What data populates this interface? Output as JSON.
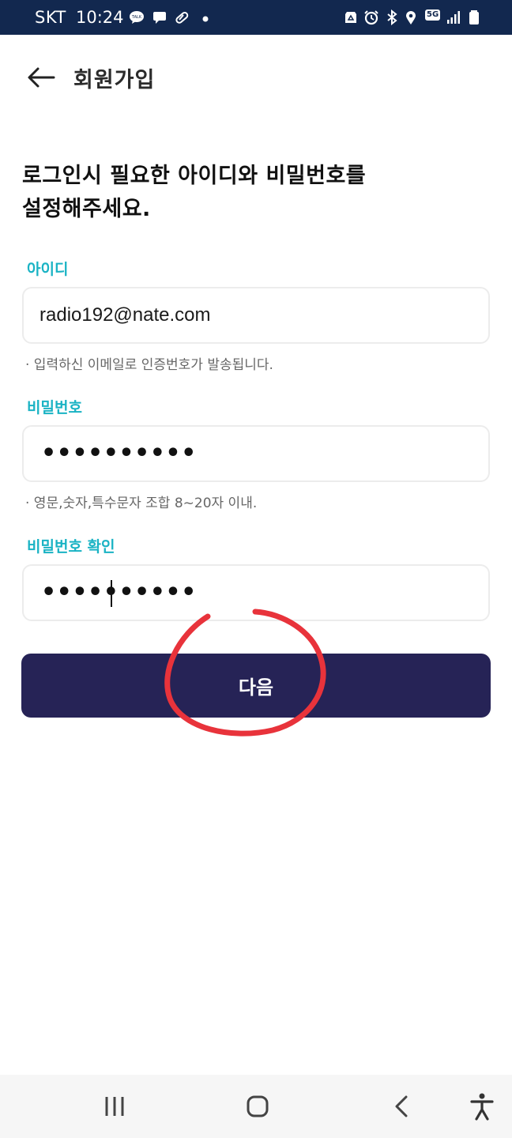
{
  "status_bar": {
    "carrier": "SKT",
    "time": "10:24",
    "network": "5G",
    "left_icons": [
      "kakaotalk-icon",
      "message-icon",
      "pill-icon",
      "dot-icon"
    ],
    "right_icons": [
      "recycle-icon",
      "alarm-icon",
      "bluetooth-icon",
      "location-icon",
      "signal-icon",
      "battery-icon"
    ]
  },
  "appbar": {
    "title": "회원가입",
    "back_icon": "arrow-left-icon"
  },
  "headline": {
    "line1": "로그인시 필요한 아이디와 비밀번호를",
    "line2": "설정해주세요."
  },
  "form": {
    "id_label": "아이디",
    "id_value": "radio192@nate.com",
    "id_hint": "· 입력하신 이메일로 인증번호가 발송됩니다.",
    "password_label": "비밀번호",
    "password_value": "••••••••••",
    "password_hint": "· 영문,숫자,특수문자 조합 8~20자 이내.",
    "password_confirm_label": "비밀번호 확인",
    "password_confirm_value": "••••••••••"
  },
  "next_button": {
    "label": "다음"
  },
  "colors": {
    "status_bar": "#12284f",
    "label_accent": "#1ab3c4",
    "button_bg": "#262356",
    "annotation": "#e8333b"
  },
  "nav_bar": {
    "icons": [
      "recent-apps-icon",
      "home-icon",
      "back-icon",
      "accessibility-icon"
    ]
  }
}
